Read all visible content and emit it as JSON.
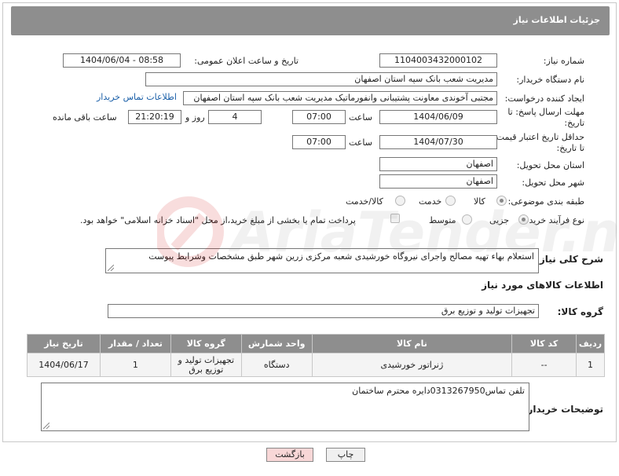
{
  "header": {
    "title": "جزئیات اطلاعات نیاز"
  },
  "fields": {
    "need_number_label": "شماره نیاز:",
    "need_number": "1104003432000102",
    "announce_label": "تاریخ و ساعت اعلان عمومی:",
    "announce_value": "1404/06/04 - 08:58",
    "buyer_org_label": "نام دستگاه خریدار:",
    "buyer_org": "مدیریت شعب بانک سپه استان اصفهان",
    "requester_label": "ایجاد کننده درخواست:",
    "requester": "مجتبی آخوندی معاونت پشتیبانی وانفورماتیک مدیریت شعب بانک سپه استان اصفهان",
    "contact_link": "اطلاعات تماس خریدار",
    "deadline_label_1": "مهلت ارسال پاسخ: تا",
    "deadline_label_2": "تاریخ:",
    "deadline_date": "1404/06/09",
    "time_label": "ساعت",
    "deadline_time": "07:00",
    "days_value": "4",
    "days_label": "روز و",
    "remaining_time": "21:20:19",
    "remaining_label": "ساعت باقی مانده",
    "price_validity_label_1": "حداقل تاریخ اعتبار قیمت:",
    "price_validity_label_2": "تا تاریخ:",
    "price_validity_date": "1404/07/30",
    "price_validity_time": "07:00",
    "province_label": "استان محل تحویل:",
    "province": "اصفهان",
    "city_label": "شهر محل تحویل:",
    "city": "اصفهان",
    "category_label": "طبقه بندی موضوعی:",
    "category_options": [
      "کالا",
      "خدمت",
      "کالا/خدمت"
    ],
    "category_selected": "کالا",
    "process_label": "نوع فرآیند خرید :",
    "process_options": [
      "جزیی",
      "متوسط"
    ],
    "process_selected": "جزیی",
    "payment_note": "پرداخت تمام یا بخشی از مبلغ خرید،از محل \"اسناد خزانه اسلامی\" خواهد بود.",
    "description_label": "شرح کلی نیاز:",
    "description": "استعلام بهاء تهیه مصالح واجرای نیروگاه خورشیدی شعبه مرکزی زرین شهر طبق مشخصات وشرایط پیوست"
  },
  "goods_section": {
    "title": "اطلاعات کالاهای مورد نیاز",
    "group_label": "گروه کالا:",
    "group_value": "تجهیزات تولید و توزیع برق"
  },
  "table": {
    "headers": [
      "ردیف",
      "کد کالا",
      "نام کالا",
      "واحد شمارش",
      "گروه کالا",
      "تعداد / مقدار",
      "تاریخ نیاز"
    ],
    "rows": [
      [
        "1",
        "--",
        "ژنراتور خورشیدی",
        "دستگاه",
        "تجهیزات تولید و توزیع برق",
        "1",
        "1404/06/17"
      ]
    ]
  },
  "buyer_notes": {
    "label": "توضیحات خریدار:",
    "text": "تلفن تماس03132679‎50دایره محترم ساختمان"
  },
  "buttons": {
    "print": "چاپ",
    "back": "بازگشت"
  },
  "colors": {
    "header_bg": "#8e8e8e",
    "link": "#1a5fa8",
    "back_button_bg": "#f8d7d7"
  }
}
